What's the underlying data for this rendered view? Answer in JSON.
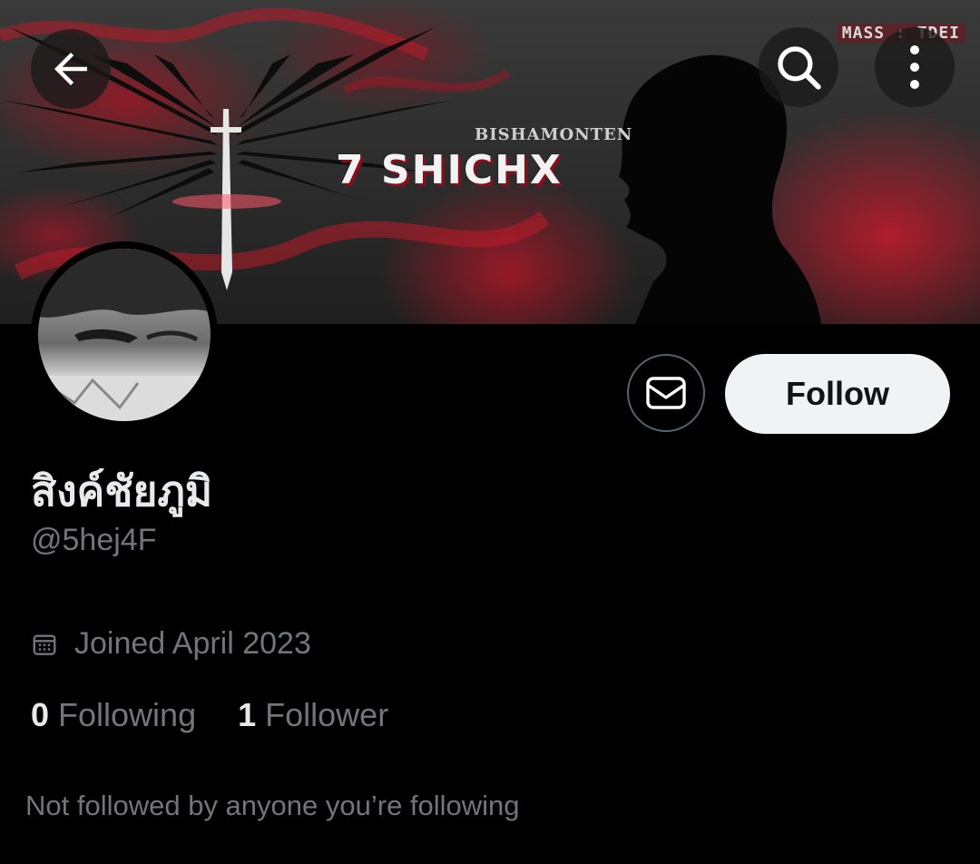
{
  "banner": {
    "watermark": "MASS : TDEI",
    "subtitle": "BISHAMONTEN",
    "title": "7 SHICHX"
  },
  "icons": {
    "back": "arrow-left-icon",
    "search": "search-icon",
    "more": "more-vertical-icon",
    "message": "envelope-icon",
    "calendar": "calendar-icon"
  },
  "profile": {
    "display_name": "สิงค์ชัยภูมิ",
    "handle": "@5hej4F",
    "joined": "Joined April 2023",
    "following_count": "0",
    "following_label": "Following",
    "followers_count": "1",
    "followers_label": "Follower",
    "followed_by": "Not followed by anyone you’re following"
  },
  "actions": {
    "follow_label": "Follow"
  },
  "colors": {
    "background": "#000000",
    "primary_text": "#e7e9ea",
    "secondary_text": "#71767b",
    "follow_button_bg": "#eff3f4",
    "border": "#536471"
  }
}
